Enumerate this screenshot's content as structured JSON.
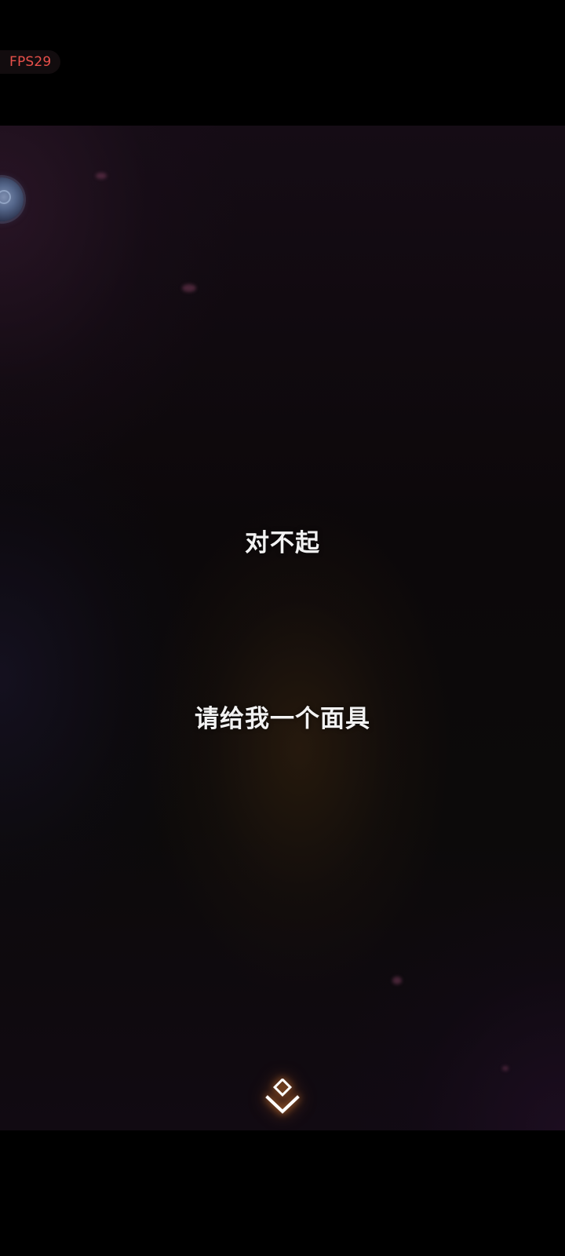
{
  "status": {
    "fps_label": "FPS29"
  },
  "dialogue": {
    "lines": [
      "对不起",
      "请给我一个面具"
    ]
  },
  "controls": {
    "advance_icon": "double-chevron-diamond-icon",
    "side_button_icon": "round-orb-icon"
  },
  "colors": {
    "fps_text": "#e8504a",
    "dialogue_text": "#f2f2f2",
    "advance_glow": "#ff9a3c",
    "letterbox": "#000000"
  }
}
